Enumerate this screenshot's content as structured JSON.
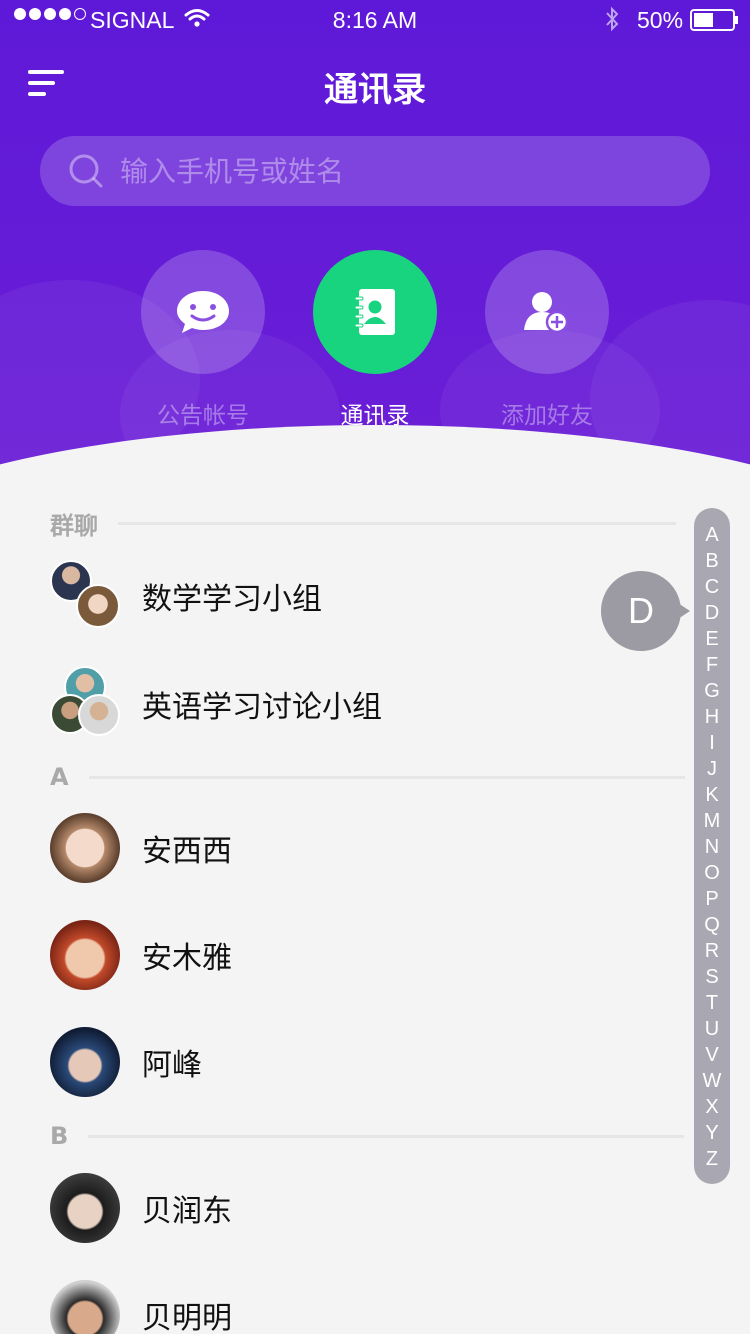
{
  "status_bar": {
    "carrier": "SIGNAL",
    "time": "8:16 AM",
    "battery": "50%",
    "signal_bars_filled": 4,
    "signal_bars_total": 5,
    "battery_level": 0.5
  },
  "header": {
    "title": "通讯录",
    "menu_icon": "menu-lines-icon"
  },
  "search": {
    "placeholder": "输入手机号或姓名",
    "value": "",
    "icon": "search-icon"
  },
  "actions": [
    {
      "label": "公告帐号",
      "icon": "chat-bubble-icon",
      "active": false
    },
    {
      "label": "通讯录",
      "icon": "contact-book-icon",
      "active": true
    },
    {
      "label": "添加好友",
      "icon": "add-user-icon",
      "active": false
    }
  ],
  "sections": {
    "groups": {
      "title": "群聊",
      "items": [
        {
          "name": "数学学习小组"
        },
        {
          "name": "英语学习讨论小组"
        }
      ]
    },
    "a": {
      "title": "A",
      "items": [
        {
          "name": "安西西"
        },
        {
          "name": "安木雅"
        },
        {
          "name": "阿峰"
        }
      ]
    },
    "b": {
      "title": "B",
      "items": [
        {
          "name": "贝润东"
        },
        {
          "name": "贝明明"
        }
      ]
    }
  },
  "index_bar": {
    "letters": [
      "A",
      "B",
      "C",
      "D",
      "E",
      "F",
      "G",
      "H",
      "I",
      "J",
      "K",
      "M",
      "N",
      "O",
      "P",
      "Q",
      "R",
      "S",
      "T",
      "U",
      "V",
      "W",
      "X",
      "Y",
      "Z"
    ],
    "current": "D"
  },
  "colors": {
    "header_purple": "#5e19d8",
    "active_green": "#19d47e",
    "index_bar_gray": "#a9a7b1"
  }
}
